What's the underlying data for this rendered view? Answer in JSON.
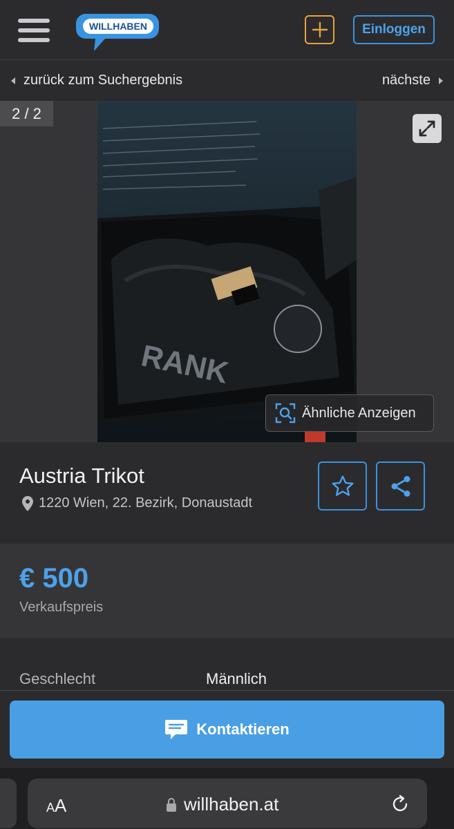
{
  "header": {
    "logo_text": "WILLHABEN",
    "add_symbol": "+",
    "login_label": "Einloggen",
    "accent_blue": "#3a93e0",
    "accent_orange": "#e9a23b"
  },
  "nav": {
    "back_label": "zurück zum Suchergebnis",
    "next_label": "nächste"
  },
  "gallery": {
    "counter": "2 / 2",
    "similar_label": "Ähnliche Anzeigen",
    "expand_icon": "expand-icon"
  },
  "ad": {
    "title": "Austria Trikot",
    "location": "1220 Wien, 22. Bezirk, Donaustadt",
    "price": "€ 500",
    "price_label": "Verkaufspreis",
    "attributes": [
      {
        "key": "Geschlecht",
        "value": "Männlich"
      }
    ]
  },
  "contact": {
    "label": "Kontaktieren"
  },
  "browser": {
    "aa_small": "A",
    "aa_large": "A",
    "url": "willhaben.at"
  }
}
